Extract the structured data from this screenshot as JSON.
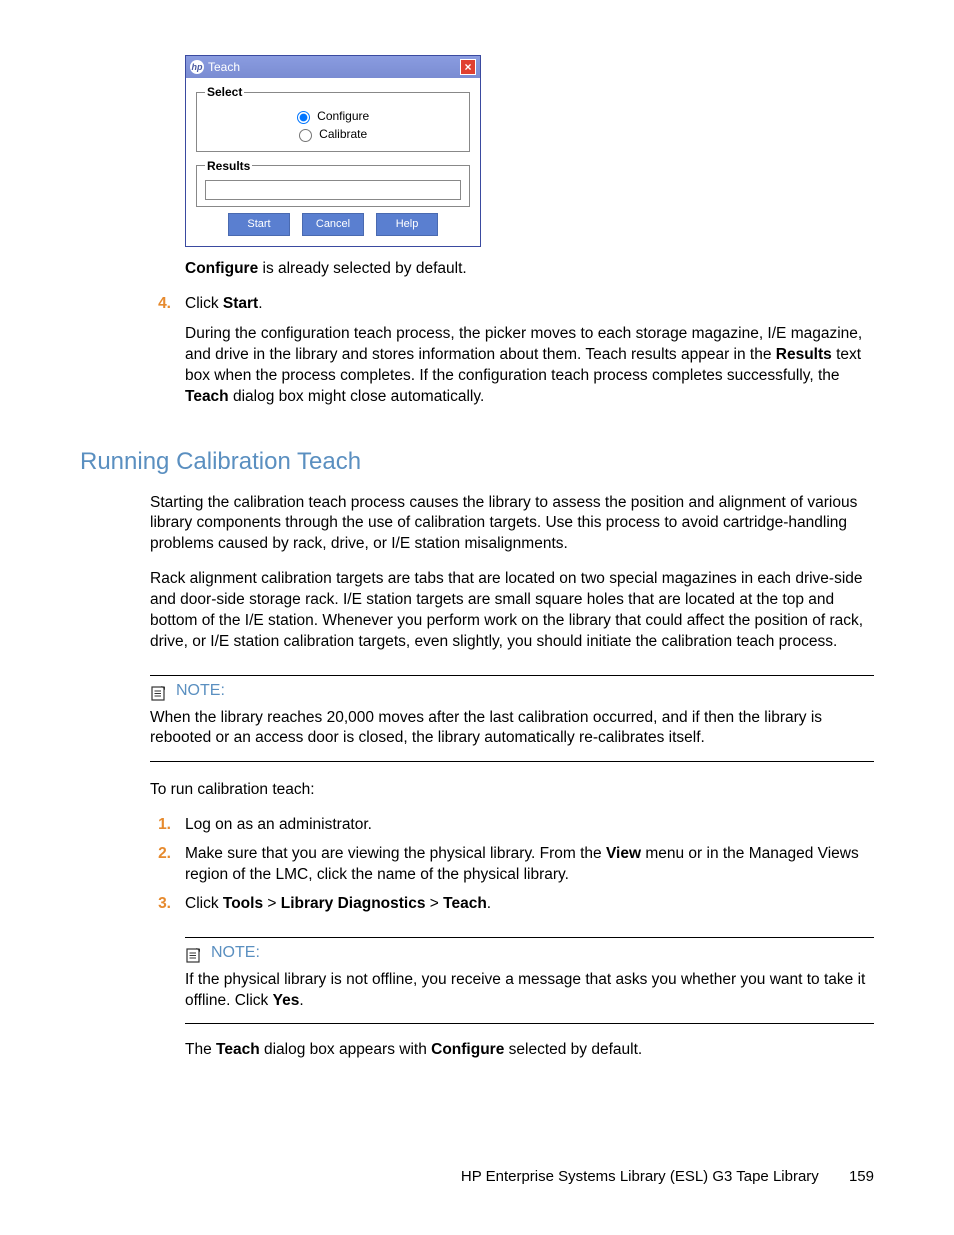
{
  "dialog": {
    "title": "Teach",
    "select_legend": "Select",
    "results_legend": "Results",
    "opt_configure": "Configure",
    "opt_calibrate": "Calibrate",
    "btn_start": "Start",
    "btn_cancel": "Cancel",
    "btn_help": "Help"
  },
  "text": {
    "configure_default_pre": "Configure",
    "configure_default_post": " is already selected by default.",
    "step4_num": "4.",
    "step4_a": "Click ",
    "step4_b": "Start",
    "step4_c": ".",
    "step4_body_1": "During the configuration teach process, the picker moves to each storage magazine, I/E magazine, and drive in the library and stores information about them. Teach results appear in the ",
    "step4_body_2": "Results",
    "step4_body_3": " text box when the process completes. If the configuration teach process completes successfully, the ",
    "step4_body_4": "Teach",
    "step4_body_5": " dialog box might close automatically.",
    "h2": "Running Calibration Teach",
    "p1": "Starting the calibration teach process causes the library to assess the position and alignment of various library components through the use of calibration targets. Use this process to avoid cartridge-handling problems caused by rack, drive, or I/E station misalignments.",
    "p2": "Rack alignment calibration targets are tabs that are located on two special magazines in each drive-side and door-side storage rack. I/E station targets are small square holes that are located at the top and bottom of the I/E station. Whenever you perform work on the library that could affect the position of rack, drive, or I/E station calibration targets, even slightly, you should initiate the calibration teach process.",
    "note1_label": "NOTE:",
    "note1_body": "When the library reaches 20,000 moves after the last calibration occurred, and if then the library is rebooted or an access door is closed, the library automatically re-calibrates itself.",
    "p3": "To run calibration teach:",
    "s1_num": "1.",
    "s1": "Log on as an administrator.",
    "s2_num": "2.",
    "s2_a": "Make sure that you are viewing the physical library. From the ",
    "s2_b": "View",
    "s2_c": " menu or in the Managed Views region of the LMC, click the name of the physical library.",
    "s3_num": "3.",
    "s3_a": "Click ",
    "s3_b": "Tools",
    "s3_c": " > ",
    "s3_d": "Library Diagnostics",
    "s3_e": " > ",
    "s3_f": "Teach",
    "s3_g": ".",
    "note2_label": "NOTE:",
    "note2_a": "If the physical library is not offline, you receive a message that asks you whether you want to take it offline. Click ",
    "note2_b": "Yes",
    "note2_c": ".",
    "p4_a": "The ",
    "p4_b": "Teach",
    "p4_c": " dialog box appears with ",
    "p4_d": "Configure",
    "p4_e": " selected by default."
  },
  "footer": {
    "title": "HP Enterprise Systems Library (ESL) G3 Tape Library",
    "page": "159"
  }
}
